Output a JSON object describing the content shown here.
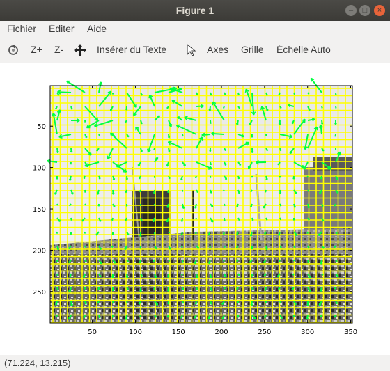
{
  "window": {
    "title": "Figure 1"
  },
  "menu": {
    "items": [
      "Fichier",
      "Éditer",
      "Aide"
    ]
  },
  "toolbar": {
    "zoom_in": "Z+",
    "zoom_out": "Z-",
    "insert_text": "Insérer du Texte",
    "axes": "Axes",
    "grid": "Grille",
    "autoscale": "Échelle Auto"
  },
  "plot": {
    "xticks": [
      "50",
      "100",
      "150",
      "200",
      "250",
      "300",
      "350"
    ],
    "yticks": [
      "50",
      "100",
      "150",
      "200",
      "250"
    ],
    "grid_color": "#ffff00",
    "arrow_color": "#00ff40",
    "xlim": [
      1,
      352
    ],
    "ylim": [
      1,
      288
    ]
  },
  "status": {
    "coords": "(71.224, 13.215)"
  }
}
